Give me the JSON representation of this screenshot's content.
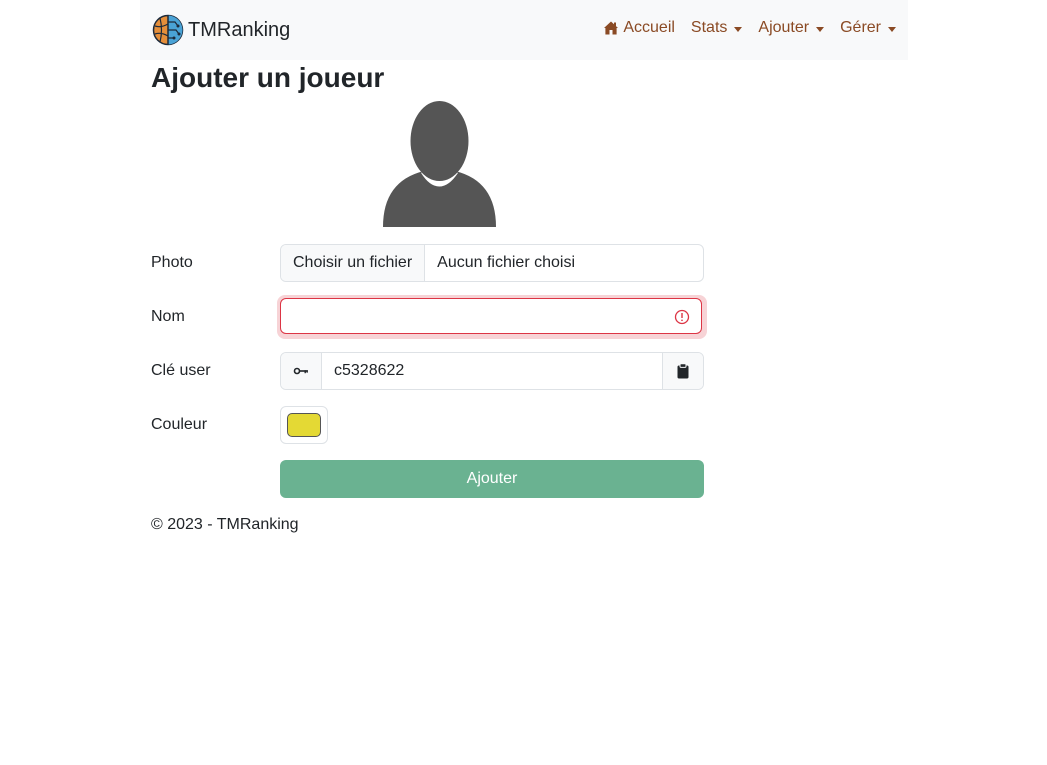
{
  "navbar": {
    "brand": "TMRanking",
    "items": [
      {
        "label": "Accueil",
        "icon": "home-icon",
        "dropdown": false
      },
      {
        "label": "Stats",
        "dropdown": true
      },
      {
        "label": "Ajouter",
        "dropdown": true
      },
      {
        "label": "Gérer",
        "dropdown": true
      }
    ]
  },
  "page": {
    "title": "Ajouter un joueur"
  },
  "form": {
    "photo": {
      "label": "Photo",
      "button": "Choisir un fichier",
      "status": "Aucun fichier choisi"
    },
    "name": {
      "label": "Nom",
      "value": "",
      "state": "invalid"
    },
    "key": {
      "label": "Clé user",
      "value": "c5328622"
    },
    "color": {
      "label": "Couleur",
      "value": "#e4d934"
    },
    "submit": "Ajouter"
  },
  "footer": {
    "text": "© 2023 - TMRanking"
  },
  "colors": {
    "accent": "#8a4a24",
    "submit": "#6ab291",
    "error": "#dc3545"
  }
}
